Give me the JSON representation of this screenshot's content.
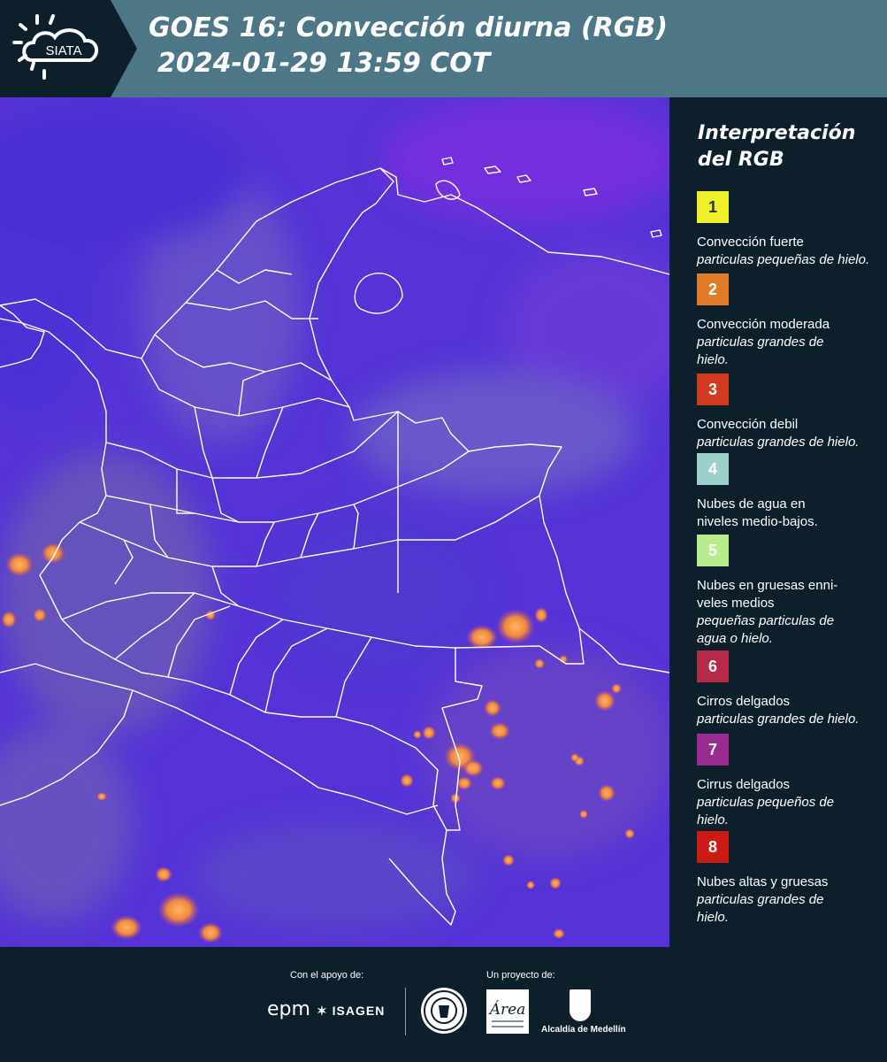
{
  "header": {
    "logo_text": "SIATA",
    "title_line1": "GOES 16: Convección diurna (RGB)",
    "title_line2": "2024-01-29 13:59 COT"
  },
  "colors": {
    "header_bg": "#4d7687",
    "panel_bg": "#0e1f2c",
    "map_base": "#5533d6",
    "border_line": "#ffffff",
    "convection_orange": "#f0883a"
  },
  "legend": {
    "title": "Interpretación del RGB",
    "items": [
      {
        "number": "1",
        "color": "#eef12a",
        "text_color": "#333333",
        "label": "Convección fuerte",
        "sub": "particulas pequeñas de hielo."
      },
      {
        "number": "2",
        "color": "#e07b2a",
        "text_color": "#ffffff",
        "label": "Convección moderada",
        "sub": "particulas grandes de hielo."
      },
      {
        "number": "3",
        "color": "#d03a1e",
        "text_color": "#ffffff",
        "label": "Convección debil",
        "sub": "particulas grandes de hielo."
      },
      {
        "number": "4",
        "color": "#9ccfc9",
        "text_color": "#ffffff",
        "label": "Nubes de agua en niveles medio-bajos.",
        "sub": ""
      },
      {
        "number": "5",
        "color": "#b7ec8c",
        "text_color": "#ffffff",
        "label": "Nubes en gruesas enni-veles medios",
        "sub": "pequeñas particulas de agua o hielo."
      },
      {
        "number": "6",
        "color": "#b52a47",
        "text_color": "#ffffff",
        "label": "Cirros delgados",
        "sub": "particulas grandes de hielo."
      },
      {
        "number": "7",
        "color": "#9a2b93",
        "text_color": "#ffffff",
        "label": "Cirrus delgados",
        "sub": "particulas pequeños de hielo."
      },
      {
        "number": "8",
        "color": "#cc1a14",
        "text_color": "#ffffff",
        "label": "Nubes altas y gruesas",
        "sub": "particulas grandes de hielo."
      }
    ]
  },
  "footer": {
    "support_label": "Con el apoyo de:",
    "project_label": "Un proyecto de:",
    "sponsor1": "epm",
    "sponsor2": "ISAGEN",
    "area_logo_text": "Área",
    "alcaldia": "Alcaldía de Medellín"
  }
}
